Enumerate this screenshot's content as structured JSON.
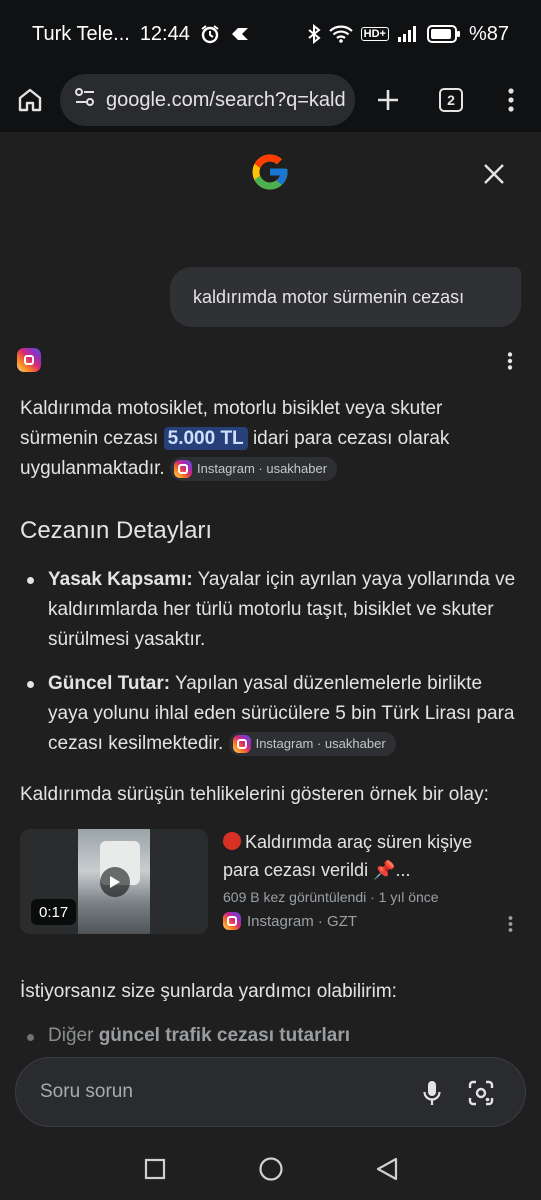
{
  "status_bar": {
    "carrier": "Turk Tele...",
    "time": "12:44",
    "hd_label": "HD+",
    "battery_percent": "%87"
  },
  "toolbar": {
    "url": "google.com/search?q=kald",
    "tab_count": "2"
  },
  "query": "kaldırımda motor sürmenin cezası",
  "answer": {
    "intro_before": "Kaldırımda motosiklet, motorlu bisiklet veya skuter sürmenin cezası",
    "intro_highlight": "5.000 TL",
    "intro_after": "idari para cezası olarak uygulanmaktadır.",
    "source_chip": "Instagram · usakhaber",
    "section_title": "Cezanın Detayları",
    "bullets": [
      {
        "label": "Yasak Kapsamı:",
        "text": "Yayalar için ayrılan yaya yollarında ve kaldırımlarda her türlü motorlu taşıt, bisiklet ve skuter sürülmesi yasaktır."
      },
      {
        "label": "Güncel Tutar:",
        "text": "Yapılan yasal düzenlemelerle birlikte yaya yolunu ihlal eden sürücülere 5 bin Türk Lirası para cezası kesilmektedir.",
        "chip": "Instagram · usakhaber"
      }
    ],
    "example_intro": "Kaldırımda sürüşün tehlikelerini gösteren örnek bir olay:",
    "video": {
      "duration": "0:17",
      "title_line1": "Kaldırımda araç süren kişiye",
      "title_line2": "para cezası verildi 📌...",
      "meta": "609 B kez görüntülendi · 1 yıl önce",
      "source": "Instagram · GZT"
    },
    "help_intro": "İstiyorsanız size şunlarda yardımcı olabilirim:",
    "faded_prefix": "Diğer",
    "faded_bold": "güncel trafik cezası tutarları"
  },
  "ask_bar": {
    "placeholder": "Soru sorun"
  },
  "colors": {
    "background": "#1f1f1f",
    "highlight": "#28407a",
    "accent_red": "#d93025"
  }
}
